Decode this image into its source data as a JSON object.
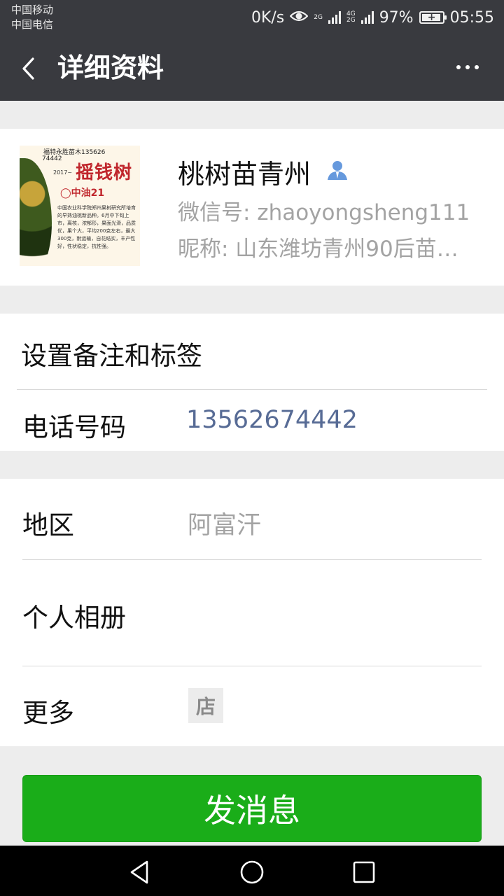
{
  "status_bar": {
    "carrier_1": "中国移动",
    "carrier_2": "中国电信",
    "net_speed": "0K/s",
    "sim1_tag": "2G",
    "sim2_tag": "4G\n2G",
    "battery": "97%",
    "time": "05:55",
    "icons": [
      "eye-icon",
      "signal-icon",
      "battery-icon"
    ]
  },
  "nav": {
    "title": "详细资料",
    "back_icon": "chevron-left-icon",
    "more_icon": "more-dots-icon"
  },
  "avatar_text": {
    "line1": "福特永胜苗木135626",
    "line2": "74442",
    "logo": "摇钱树",
    "year": "2017~",
    "brand": "◯中油21",
    "body": "中国农业科学院郑州果树研究所培育的早熟油桃新品种。6月中下旬上市，离核，浓郁形，果面光滑，品质优，果个大，平均200克左右，最大300克，耐运输，自花结实，丰产性好，性状稳定，抗性强。"
  },
  "profile": {
    "name": "桃树苗青州",
    "gender_icon": "user-badge-icon",
    "wechat_id": "微信号: zhaoyongsheng111",
    "nickname": "昵称: 山东潍坊青州90后苗…"
  },
  "rows": {
    "remark_label": "设置备注和标签",
    "phone_label": "电话号码",
    "phone_value": "13562674442",
    "region_label": "地区",
    "region_value": "阿富汗",
    "album_label": "个人相册",
    "more_label": "更多",
    "shop_badge": "店"
  },
  "actions": {
    "send_message": "发消息"
  },
  "system_nav": [
    "back-triangle-icon",
    "home-circle-icon",
    "recents-square-icon"
  ],
  "colors": {
    "nav_bg": "#393a3f",
    "page_bg": "#ededed",
    "primary_green": "#1aad19",
    "link_blue": "#576b95",
    "secondary_text": "#a3a3a3"
  }
}
